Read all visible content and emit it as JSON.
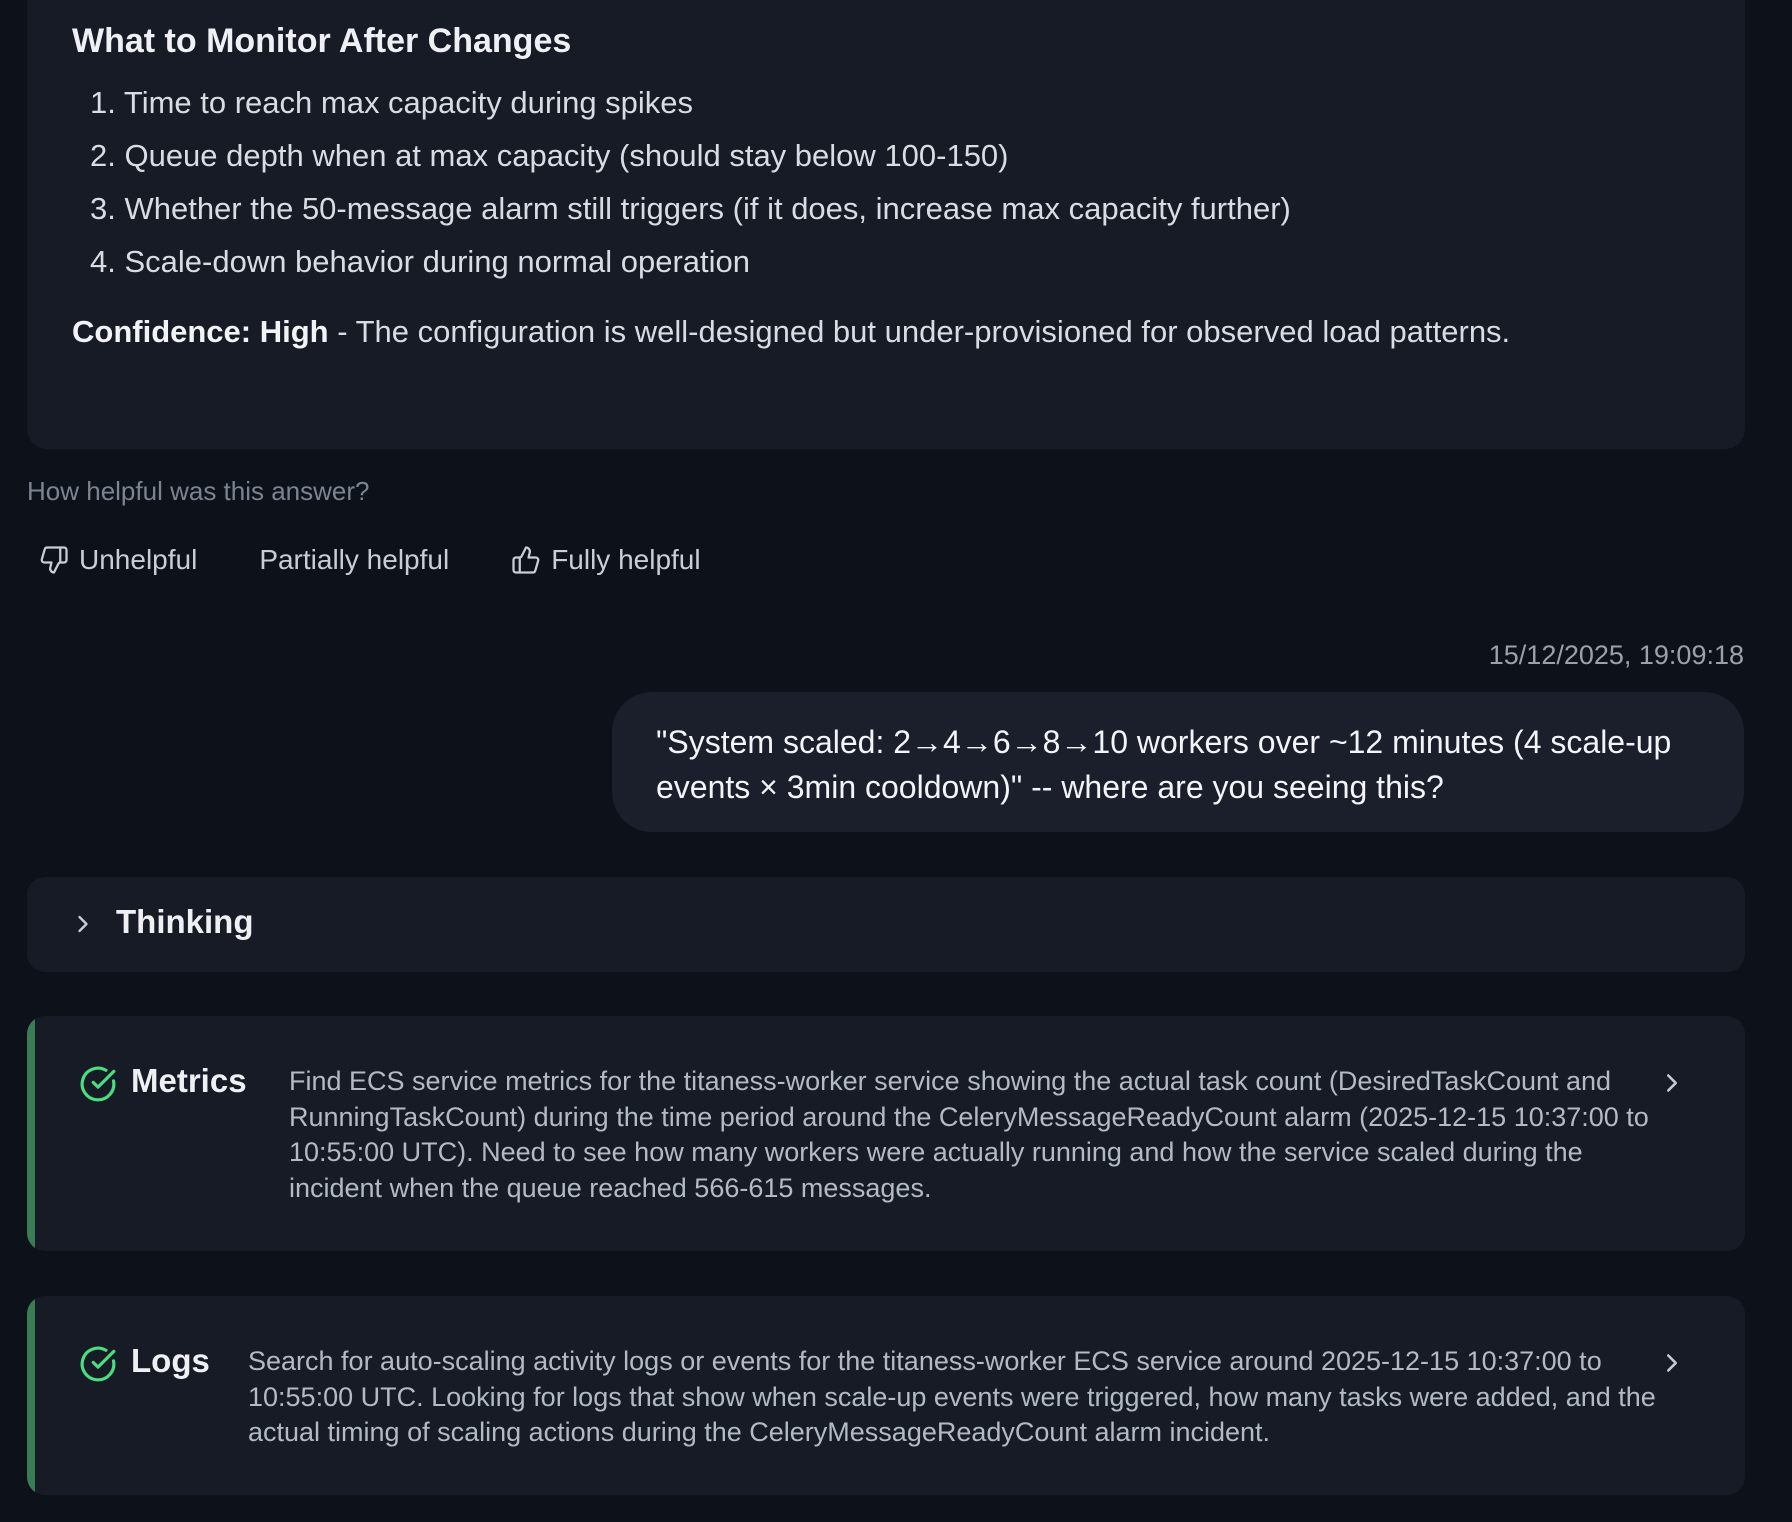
{
  "answer": {
    "heading": "What to Monitor After Changes",
    "list": [
      "1. Time to reach max capacity during spikes",
      "2. Queue depth when at max capacity (should stay below 100-150)",
      "3. Whether the 50-message alarm still triggers (if it does, increase max capacity further)",
      "4. Scale-down behavior during normal operation"
    ],
    "confidence_label": "Confidence: High",
    "confidence_text": " - The configuration is well-designed but under-provisioned for observed load patterns."
  },
  "feedback": {
    "question": "How helpful was this answer?",
    "unhelpful": "Unhelpful",
    "partial": "Partially helpful",
    "fully": "Fully helpful"
  },
  "user_message": {
    "timestamp": "15/12/2025, 19:09:18",
    "text": "\"System scaled: 2→4→6→8→10 workers over ~12 minutes (4 scale-up events × 3min cooldown)\" -- where are you seeing this?"
  },
  "thinking": {
    "label": "Thinking"
  },
  "steps": [
    {
      "title": "Metrics",
      "description": "Find ECS service metrics for the titaness-worker service showing the actual task count (DesiredTaskCount and RunningTaskCount) during the time period around the CeleryMessageReadyCount alarm (2025-12-15 10:37:00 to 10:55:00 UTC). Need to see how many workers were actually running and how the service scaled during the incident when the queue reached 566-615 messages."
    },
    {
      "title": "Logs",
      "description": "Search for auto-scaling activity logs or events for the titaness-worker ECS service around 2025-12-15 10:37:00 to 10:55:00 UTC. Looking for logs that show when scale-up events were triggered, how many tasks were added, and the actual timing of scaling actions during the CeleryMessageReadyCount alarm incident."
    }
  ],
  "colors": {
    "background": "#0d111a",
    "card": "#161b26",
    "user_bubble": "#1a1f2b",
    "success": "#4ade80",
    "accent_bar": "#3a7d55"
  }
}
